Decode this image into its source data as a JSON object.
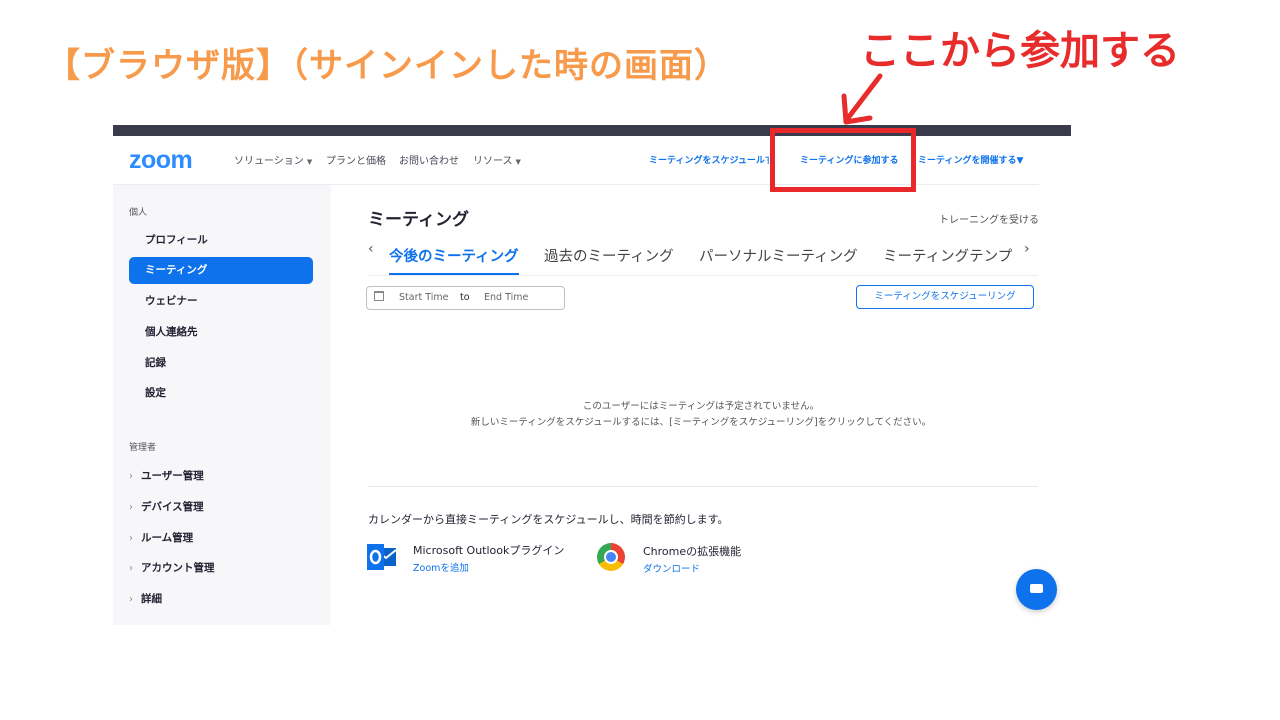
{
  "slide": {
    "title": "【ブラウザ版】（サインインした時の画面）",
    "callout": "ここから参加する"
  },
  "header": {
    "logo": "zoom",
    "nav": [
      "ソリューション",
      "プランと価格",
      "お問い合わせ",
      "リソース"
    ],
    "schedule": "ミーティングをスケジュールする",
    "join": "ミーティングに参加する",
    "host": "ミーティングを開催する"
  },
  "sidebar": {
    "section_personal": "個人",
    "items": [
      "プロフィール",
      "ミーティング",
      "ウェビナー",
      "個人連絡先",
      "記録",
      "設定"
    ],
    "section_admin": "管理者",
    "admin_items": [
      "ユーザー管理",
      "デバイス管理",
      "ルーム管理",
      "アカウント管理",
      "詳細"
    ]
  },
  "main": {
    "title": "ミーティング",
    "training": "トレーニングを受ける",
    "tabs": [
      "今後のミーティング",
      "過去のミーティング",
      "パーソナルミーティング",
      "ミーティングテンプ"
    ],
    "date_start": "Start Time",
    "date_to": "to",
    "date_end": "End Time",
    "schedule_button": "ミーティングをスケジューリング",
    "empty_line1": "このユーザーにはミーティングは予定されていません。",
    "empty_line2": "新しいミーティングをスケジュールするには、[ミーティングをスケジューリング]をクリックしてください。",
    "calendar_text": "カレンダーから直接ミーティングをスケジュールし、時間を節約します。",
    "outlook_name": "Microsoft Outlookプラグイン",
    "outlook_link": "Zoomを追加",
    "chrome_name": "Chromeの拡張機能",
    "chrome_link": "ダウンロード"
  },
  "colors": {
    "title": "#f79a4b",
    "callout": "#e82c2c",
    "accent": "#0e72ed"
  }
}
